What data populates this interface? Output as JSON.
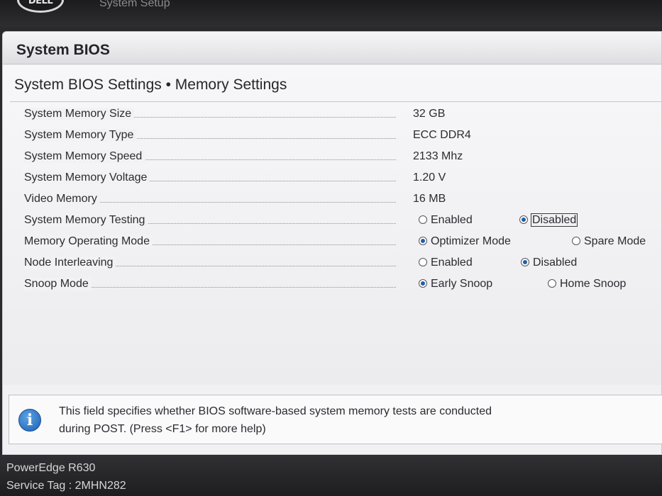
{
  "window": {
    "logo_text": "DELL",
    "app_title": "System Setup"
  },
  "header": {
    "title": "System BIOS"
  },
  "page": {
    "subtitle": "System BIOS Settings • Memory Settings"
  },
  "settings": [
    {
      "label": "System Memory Size",
      "value": "32 GB"
    },
    {
      "label": "System Memory Type",
      "value": "ECC DDR4"
    },
    {
      "label": "System Memory Speed",
      "value": "2133 Mhz"
    },
    {
      "label": "System Memory Voltage",
      "value": "1.20 V"
    },
    {
      "label": "Video Memory",
      "value": "16 MB"
    },
    {
      "label": "System Memory Testing",
      "options": [
        {
          "label": "Enabled",
          "selected": false
        },
        {
          "label": "Disabled",
          "selected": true
        }
      ]
    },
    {
      "label": "Memory Operating Mode",
      "options": [
        {
          "label": "Optimizer Mode",
          "selected": true
        },
        {
          "label": "Spare Mode",
          "selected": false
        }
      ]
    },
    {
      "label": "Node Interleaving",
      "options": [
        {
          "label": "Enabled",
          "selected": false
        },
        {
          "label": "Disabled",
          "selected": true
        }
      ]
    },
    {
      "label": "Snoop Mode",
      "options": [
        {
          "label": "Early Snoop",
          "selected": true
        },
        {
          "label": "Home Snoop",
          "selected": false
        }
      ]
    }
  ],
  "help": {
    "icon": "info-icon",
    "line1": "This field specifies whether BIOS software-based system memory tests are conducted",
    "line2": "during POST. (Press <F1> for more help)"
  },
  "footer": {
    "model": "PowerEdge R630",
    "service_tag": "Service Tag : 2MHN282"
  },
  "colors": {
    "accent": "#1f5fa8",
    "panel": "#f1f1f4",
    "frame": "#2a2a2c"
  }
}
